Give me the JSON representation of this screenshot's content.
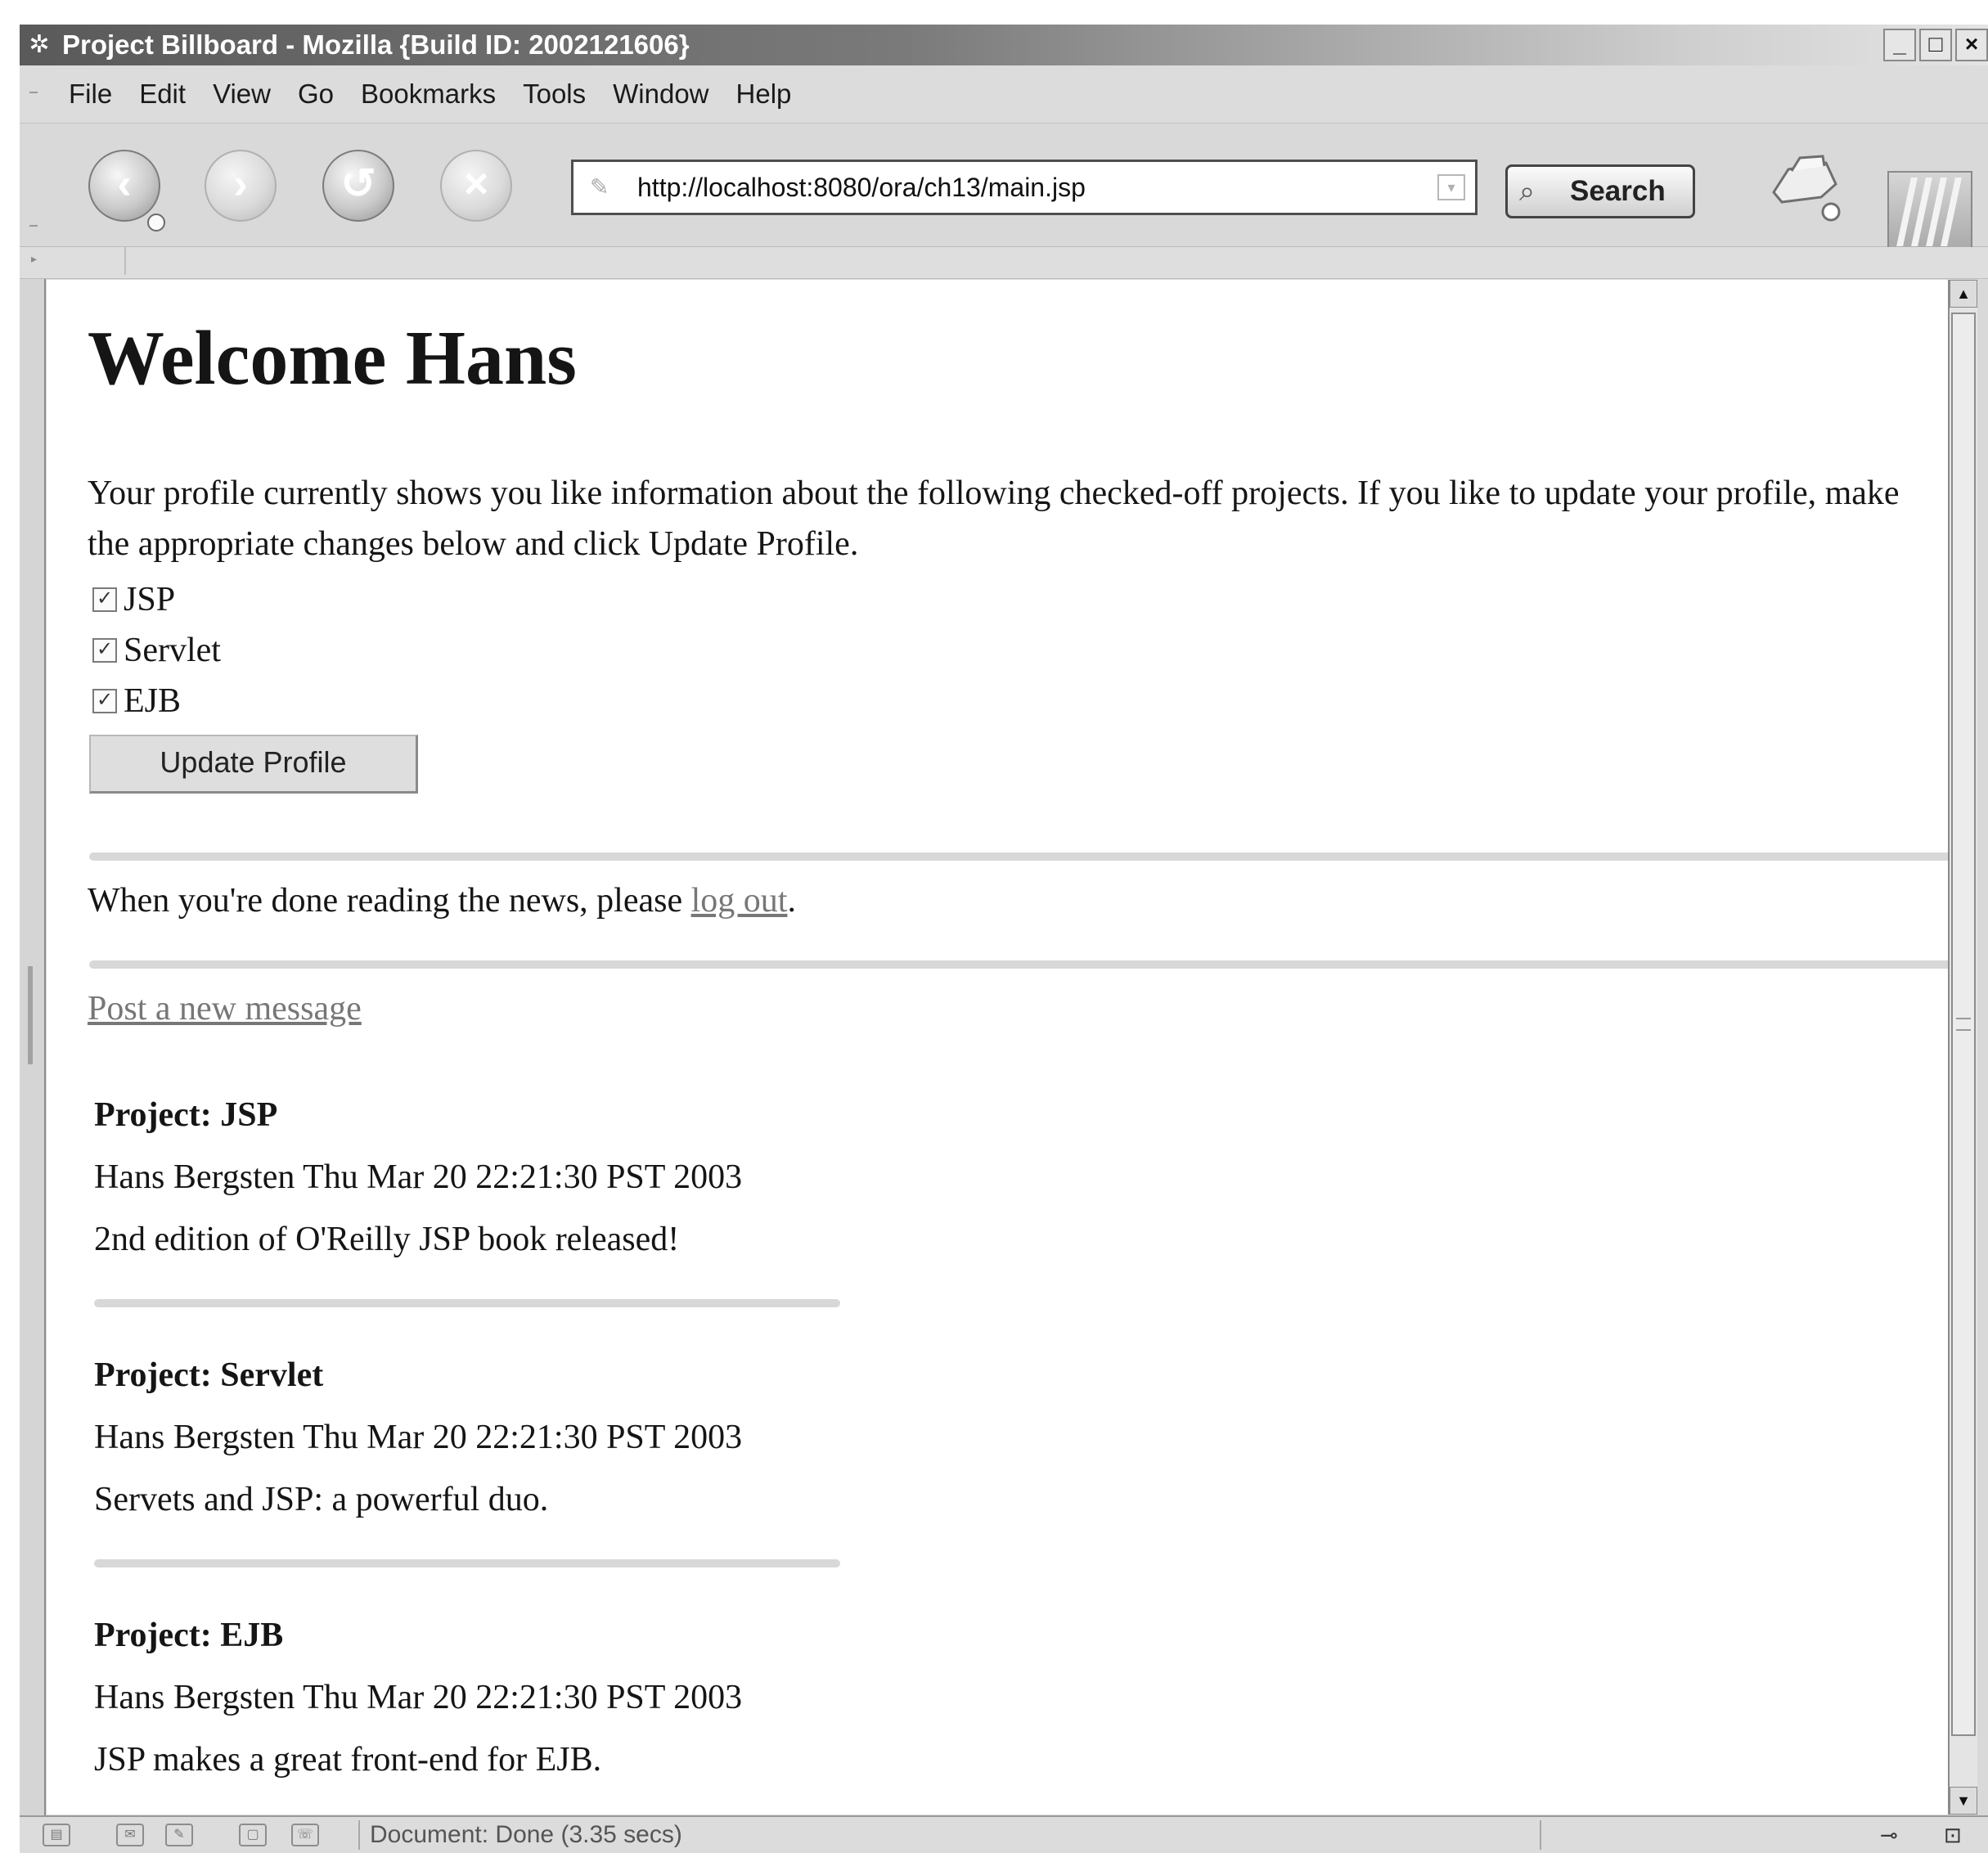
{
  "window": {
    "title": "Project Billboard - Mozilla {Build ID: 2002121606}",
    "controls": {
      "minimize": "_",
      "maximize": "□",
      "close": "×"
    }
  },
  "menu": {
    "items": [
      {
        "label": "File"
      },
      {
        "label": "Edit"
      },
      {
        "label": "View"
      },
      {
        "label": "Go"
      },
      {
        "label": "Bookmarks"
      },
      {
        "label": "Tools"
      },
      {
        "label": "Window"
      },
      {
        "label": "Help"
      }
    ]
  },
  "toolbar": {
    "back_icon": "back-arrow-icon",
    "forward_icon": "forward-arrow-icon",
    "reload_icon": "reload-icon",
    "stop_icon": "stop-icon",
    "url": "http://localhost:8080/ora/ch13/main.jsp",
    "search_label": "Search",
    "print_icon": "printer-icon",
    "logo_icon": "mozilla-logo"
  },
  "page": {
    "heading": "Welcome Hans",
    "intro": "Your profile currently shows you like information about the following checked-off projects. If you like to update your profile, make the appropriate changes below and click Update Profile.",
    "projects": [
      {
        "label": "JSP",
        "checked": true
      },
      {
        "label": "Servlet",
        "checked": true
      },
      {
        "label": "EJB",
        "checked": true
      }
    ],
    "update_button": "Update Profile",
    "logout_prefix": "When you're done reading the news, please ",
    "logout_link": "log out",
    "logout_suffix": ".",
    "post_link": "Post a new message",
    "messages": [
      {
        "project": "Project: JSP",
        "meta": "Hans Bergsten Thu Mar 20 22:21:30 PST 2003",
        "body": "2nd edition of O'Reilly JSP book released!"
      },
      {
        "project": "Project: Servlet",
        "meta": "Hans Bergsten Thu Mar 20 22:21:30 PST 2003",
        "body": "Servets and JSP: a powerful duo."
      },
      {
        "project": "Project: EJB",
        "meta": "Hans Bergsten Thu Mar 20 22:21:30 PST 2003",
        "body": "JSP makes a great front-end for EJB."
      }
    ]
  },
  "status": {
    "text": "Document: Done (3.35 secs)"
  }
}
